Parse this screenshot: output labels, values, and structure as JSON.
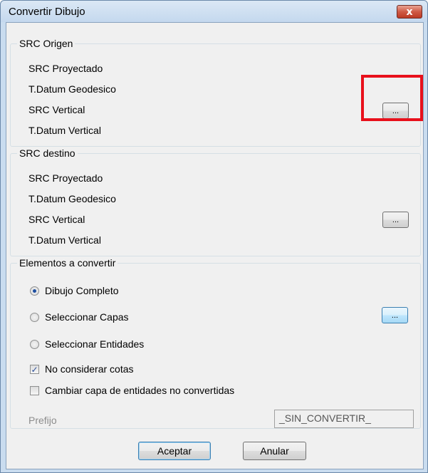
{
  "window": {
    "title": "Convertir Dibujo",
    "close_label": "x"
  },
  "src_origen": {
    "legend": "SRC Origen",
    "rows": [
      "SRC Proyectado",
      "T.Datum Geodesico",
      "SRC Vertical",
      "T.Datum Vertical"
    ],
    "button_label": "..."
  },
  "src_destino": {
    "legend": "SRC destino",
    "rows": [
      "SRC Proyectado",
      "T.Datum Geodesico",
      "SRC Vertical",
      "T.Datum Vertical"
    ],
    "button_label": "..."
  },
  "elementos": {
    "legend": "Elementos a convertir",
    "radios": [
      {
        "label": "Dibujo Completo",
        "selected": true
      },
      {
        "label": "Seleccionar Capas",
        "selected": false
      },
      {
        "label": "Seleccionar Entidades",
        "selected": false
      }
    ],
    "capas_button_label": "...",
    "checkboxes": [
      {
        "label": "No considerar cotas",
        "checked": true,
        "check_glyph": "✓"
      },
      {
        "label": "Cambiar capa de entidades no convertidas",
        "checked": false,
        "check_glyph": ""
      }
    ],
    "prefix_label": "Prefijo",
    "prefix_value": "_SIN_CONVERTIR_"
  },
  "buttons": {
    "accept": "Aceptar",
    "cancel": "Anular"
  },
  "colors": {
    "highlight": "#e8101b",
    "title_bar": "#c4d8ee",
    "close_button": "#cf5a45"
  },
  "icons": {
    "close": "close-icon"
  }
}
